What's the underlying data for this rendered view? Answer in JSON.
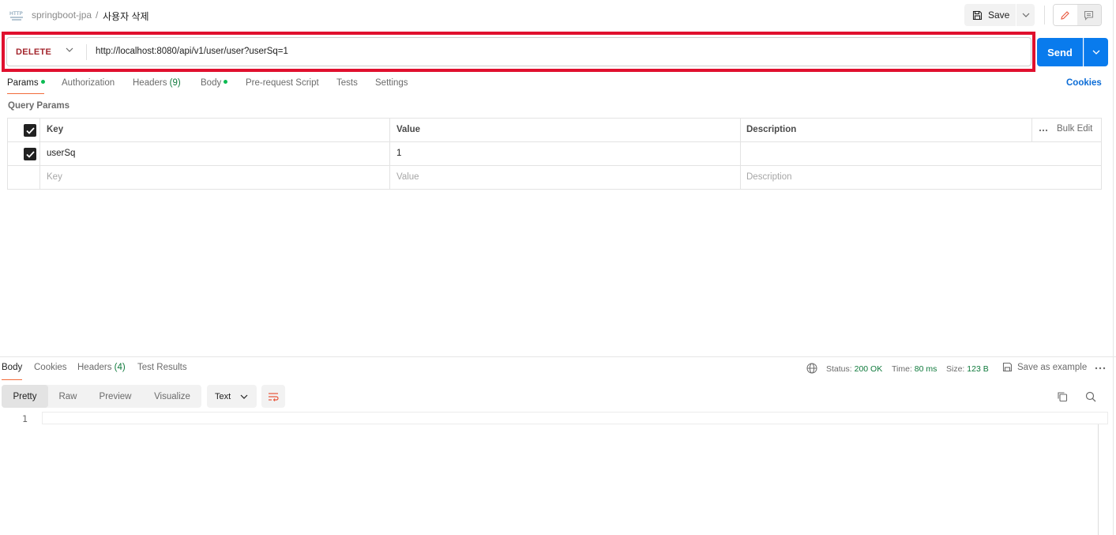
{
  "breadcrumb": {
    "parent": "springboot-jpa",
    "separator": "/",
    "current": "사용자 삭제"
  },
  "toolbar": {
    "save_label": "Save"
  },
  "request": {
    "method": "DELETE",
    "url": "http://localhost:8080/api/v1/user/user?userSq=1",
    "send_label": "Send"
  },
  "request_tabs": {
    "params": "Params",
    "authorization": "Authorization",
    "headers": "Headers",
    "headers_count": "(9)",
    "body": "Body",
    "prerequest": "Pre-request Script",
    "tests": "Tests",
    "settings": "Settings",
    "cookies": "Cookies"
  },
  "query_params": {
    "title": "Query Params",
    "headers": {
      "key": "Key",
      "value": "Value",
      "description": "Description",
      "bulk_edit": "Bulk Edit"
    },
    "rows": [
      {
        "key": "userSq",
        "value": "1",
        "description": "",
        "checked": true
      }
    ],
    "placeholders": {
      "key": "Key",
      "value": "Value",
      "description": "Description"
    }
  },
  "response": {
    "tabs": {
      "body": "Body",
      "cookies": "Cookies",
      "headers": "Headers",
      "headers_count": "(4)",
      "test_results": "Test Results"
    },
    "status_label": "Status:",
    "status_value": "200 OK",
    "time_label": "Time:",
    "time_value": "80 ms",
    "size_label": "Size:",
    "size_value": "123 B",
    "save_example": "Save as example",
    "views": [
      "Pretty",
      "Raw",
      "Preview",
      "Visualize"
    ],
    "format": "Text",
    "line_numbers": [
      "1"
    ]
  },
  "colors": {
    "send": "#097bed",
    "method_delete": "#a3262d",
    "highlight": "#e0102e",
    "status_ok": "#0f7a3c",
    "active_tab": "#f26b3a"
  }
}
